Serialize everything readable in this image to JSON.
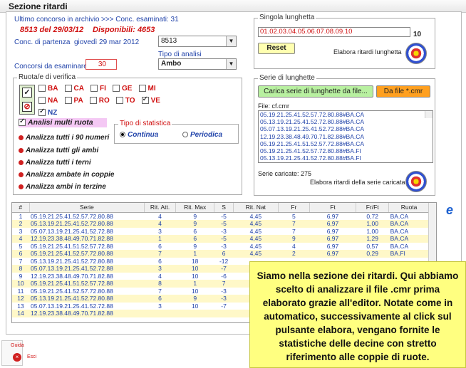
{
  "window": {
    "title": "Sezione ritardi"
  },
  "concorso": {
    "header_label": "Ultimo concorso in archivio",
    "examined_label": ">>> Conc. esaminati: 31",
    "last_draw": "8513 del 29/03/12",
    "available": "Disponibili: 4653",
    "start_label": "Conc. di partenza",
    "start_date": "giovedì 29 mar 2012",
    "start_value": "8513",
    "count_label": "Concorsi da esaminare",
    "count_value": "30",
    "analysis_type_label": "Tipo di analisi",
    "analysis_type_value": "Ambo"
  },
  "ruote": {
    "section_label": "Ruota/e di verifica",
    "items": [
      {
        "name": "BA",
        "checked": false
      },
      {
        "name": "CA",
        "checked": false
      },
      {
        "name": "FI",
        "checked": false
      },
      {
        "name": "GE",
        "checked": false
      },
      {
        "name": "MI",
        "checked": false
      },
      {
        "name": "NA",
        "checked": false
      },
      {
        "name": "PA",
        "checked": false
      },
      {
        "name": "RO",
        "checked": false
      },
      {
        "name": "TO",
        "checked": false
      },
      {
        "name": "VE",
        "checked": true
      },
      {
        "name": "NZ",
        "checked": true
      }
    ]
  },
  "multi": {
    "label": "Analisi multi ruota",
    "checked": true
  },
  "stat_type": {
    "label": "Tipo di statistica",
    "continua": "Continua",
    "periodica": "Periodica",
    "selected": "continua"
  },
  "actions": [
    "Analizza tutti i 90 numeri",
    "Analizza tutti gli ambi",
    "Analizza tutti i terni",
    "Analizza ambate in coppie",
    "Analizza ambi in terzine"
  ],
  "singola": {
    "label": "Singola lunghetta",
    "value": "01.02.03.04.05.06.07.08.09.10",
    "count": "10",
    "reset_label": "Reset",
    "elabora_label": "Elabora ritardi lunghetta"
  },
  "serie": {
    "label": "Serie di lunghette",
    "load_button": "Carica serie di lunghette da file...",
    "cmr_button": "Da file *.cmr",
    "file_label": "File: cf.cmr",
    "items": [
      "05.19.21.25.41.52.57.72.80.88#BA.CA",
      "05.13.19.21.25.41.52.72.80.88#BA.CA",
      "05.07.13.19.21.25.41.52.72.88#BA.CA",
      "12.19.23.38.48.49.70.71.82.88#BA.CA",
      "05.19.21.25.41.51.52.57.72.88#BA.CA",
      "05.19.21.25.41.52.57.72.80.88#BA.FI",
      "05.13.19.21.25.41.52.72.80.88#BA.FI"
    ],
    "loaded_label": "Serie caricate: 275",
    "elabora_label": "Elabora ritardi della serie caricata"
  },
  "table": {
    "headers": [
      "#",
      "Serie",
      "Rit. Att.",
      "Rit. Max",
      "S",
      "Rit. Nat",
      "Fr",
      "Ft",
      "Fr/Ft",
      "Ruota"
    ],
    "rows": [
      [
        "1",
        "05.19.21.25.41.52.57.72.80.88",
        "4",
        "9",
        "-5",
        "4,45",
        "5",
        "6,97",
        "0,72",
        "BA.CA"
      ],
      [
        "2",
        "05.13.19.21.25.41.52.72.80.88",
        "4",
        "9",
        "-5",
        "4,45",
        "7",
        "6,97",
        "1,00",
        "BA.CA"
      ],
      [
        "3",
        "05.07.13.19.21.25.41.52.72.88",
        "3",
        "6",
        "-3",
        "4,45",
        "7",
        "6,97",
        "1,00",
        "BA.CA"
      ],
      [
        "4",
        "12.19.23.38.48.49.70.71.82.88",
        "1",
        "6",
        "-5",
        "4,45",
        "9",
        "6,97",
        "1,29",
        "BA.CA"
      ],
      [
        "5",
        "05.19.21.25.41.51.52.57.72.88",
        "6",
        "9",
        "-3",
        "4,45",
        "4",
        "6,97",
        "0,57",
        "BA.CA"
      ],
      [
        "6",
        "05.19.21.25.41.52.57.72.80.88",
        "7",
        "1",
        "6",
        "4,45",
        "2",
        "6,97",
        "0,29",
        "BA.FI"
      ],
      [
        "7",
        "05.13.19.21.25.41.52.72.80.88",
        "6",
        "18",
        "-12",
        "",
        "",
        "",
        "",
        ""
      ],
      [
        "8",
        "05.07.13.19.21.25.41.52.72.88",
        "3",
        "10",
        "-7",
        "",
        "",
        "",
        "",
        ""
      ],
      [
        "9",
        "12.19.23.38.48.49.70.71.82.88",
        "4",
        "10",
        "-6",
        "",
        "",
        "",
        "",
        ""
      ],
      [
        "10",
        "05.19.21.25.41.51.52.57.72.88",
        "8",
        "1",
        "7",
        "",
        "",
        "",
        "",
        ""
      ],
      [
        "11",
        "05.19.21.25.41.52.57.72.80.88",
        "7",
        "10",
        "-3",
        "",
        "",
        "",
        "",
        ""
      ],
      [
        "12",
        "05.13.19.21.25.41.52.72.80.88",
        "6",
        "9",
        "-3",
        "",
        "",
        "",
        "",
        ""
      ],
      [
        "13",
        "05.07.13.19.21.25.41.52.72.88",
        "3",
        "10",
        "-7",
        "",
        "",
        "",
        "",
        ""
      ],
      [
        "14",
        "12.19.23.38.48.49.70.71.82.88",
        "",
        "",
        "",
        "",
        "",
        "",
        "",
        ""
      ]
    ]
  },
  "footer": {
    "guida": "Guida",
    "esci": "Esci"
  },
  "popup": {
    "text": "Siamo nella sezione dei ritardi. Qui abbiamo scelto di analizzare il file .cmr prima elaborato grazie all'editor. Notate come in automatico, successivamente al click sul pulsante elabora, vengano fornite le statistiche delle decine con stretto riferimento alle coppie di ruote."
  }
}
